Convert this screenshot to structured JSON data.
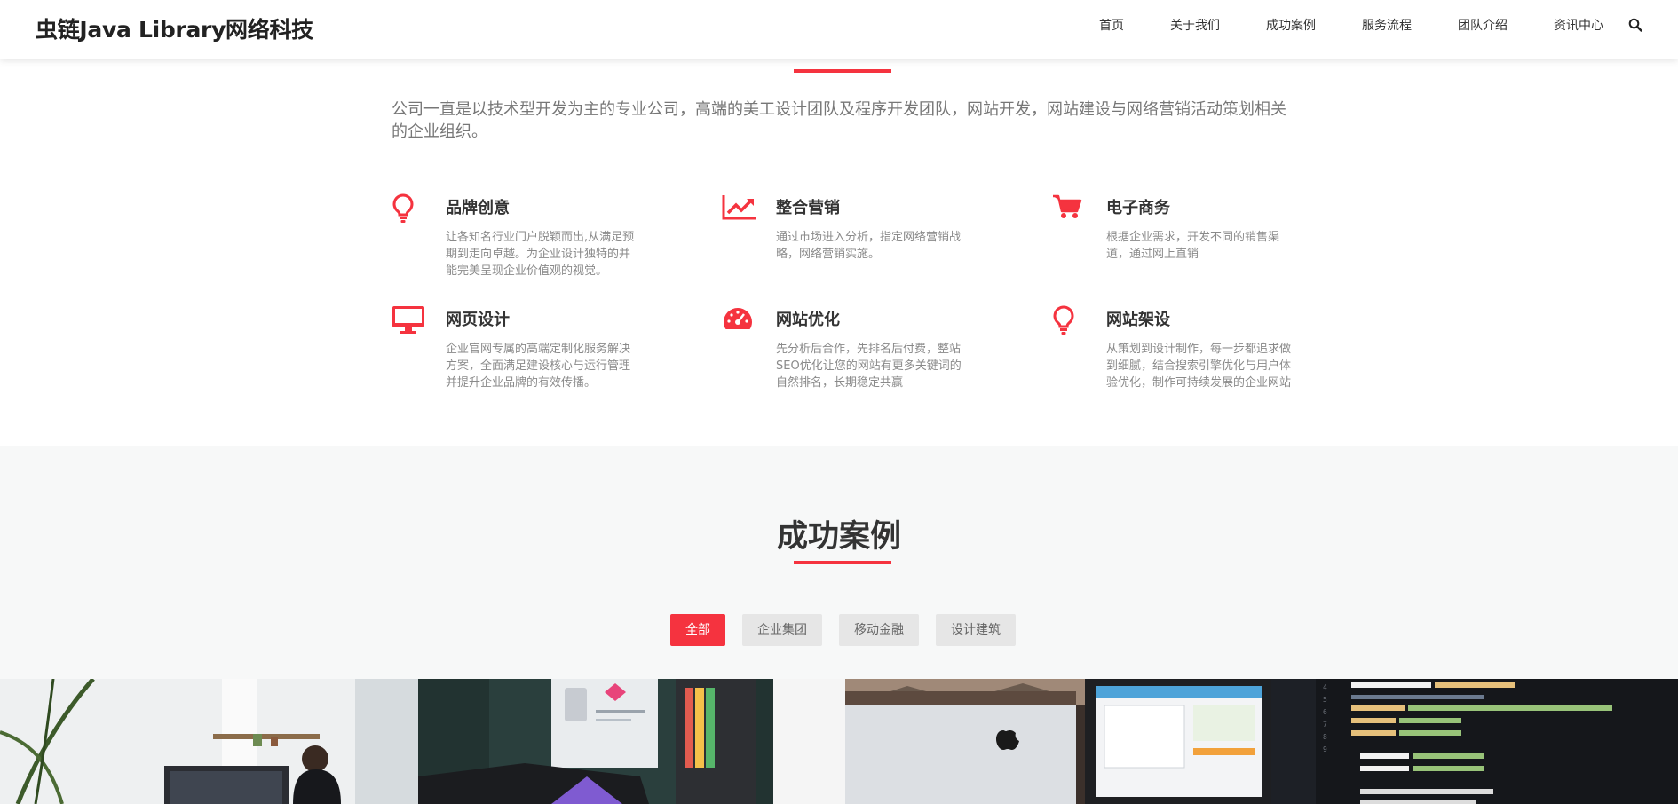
{
  "header": {
    "brand": "虫链Java Library网络科技",
    "nav": [
      "首页",
      "关于我们",
      "成功案例",
      "服务流程",
      "团队介绍",
      "资讯中心"
    ],
    "search_icon": "search-icon"
  },
  "about": {
    "intro": "公司一直是以技术型开发为主的专业公司，高端的美工设计团队及程序开发团队，网站开发，网站建设与网络营销活动策划相关的企业组织。",
    "accent_color": "#f5333f",
    "features": [
      {
        "icon": "lightbulb-icon",
        "title": "品牌创意",
        "text": "让各知名行业门户脱颖而出,从满足预期到走向卓越。为企业设计独特的并能完美呈现企业价值观的视觉。"
      },
      {
        "icon": "chart-line-icon",
        "title": "整合营销",
        "text": "通过市场进入分析，指定网络营销战略，网络营销实施。"
      },
      {
        "icon": "cart-icon",
        "title": "电子商务",
        "text": "根据企业需求，开发不同的销售渠道，通过网上直销"
      },
      {
        "icon": "monitor-icon",
        "title": "网页设计",
        "text": "企业官网专属的高端定制化服务解决方案，全面满足建设核心与运行管理并提升企业品牌的有效传播。"
      },
      {
        "icon": "dashboard-icon",
        "title": "网站优化",
        "text": "先分析后合作，先排名后付费，整站SEO优化让您的网站有更多关键词的自然排名，长期稳定共赢"
      },
      {
        "icon": "lightbulb-icon",
        "title": "网站架设",
        "text": "从策划到设计制作，每一步都追求做到细腻，结合搜索引擎优化与用户体验优化，制作可持续发展的企业网站"
      }
    ]
  },
  "cases": {
    "title": "成功案例",
    "filters": [
      "全部",
      "企业集团",
      "移动金融",
      "设计建筑"
    ],
    "active_filter": "全部"
  }
}
